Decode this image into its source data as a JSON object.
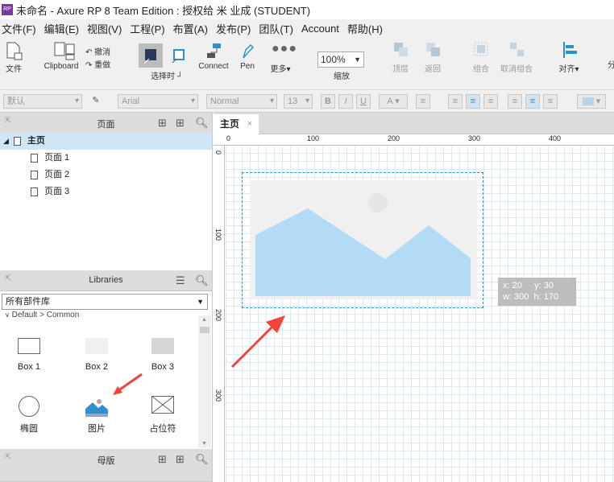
{
  "window": {
    "title": "未命名 - Axure RP 8 Team Edition : 授权给 米 业成 (STUDENT)",
    "logo": "RP"
  },
  "menu": [
    "文件(F)",
    "编辑(E)",
    "视图(V)",
    "工程(P)",
    "布置(A)",
    "发布(P)",
    "团队(T)",
    "Account",
    "帮助(H)"
  ],
  "toolbar": {
    "file": "文件",
    "clipboard": "Clipboard",
    "undo": "撤消",
    "redo": "重做",
    "select": "选择时",
    "connect": "Connect",
    "pen": "Pen",
    "more": "更多▾",
    "zoom_value": "100%",
    "zoom": "缩放",
    "top": "顶层",
    "back": "返回",
    "group": "组合",
    "ungroup": "取消组合",
    "align": "对齐▾",
    "dist": "分"
  },
  "formatbar": {
    "style": "默认",
    "font": "Arial",
    "weight": "Normal",
    "size": "13",
    "bold": "B",
    "italic": "I",
    "underline": "U",
    "color_a": "A"
  },
  "pages": {
    "title": "页面",
    "root": "主页",
    "children": [
      "页面 1",
      "页面 2",
      "页面 3"
    ]
  },
  "libraries": {
    "title": "Libraries",
    "select": "所有部件库",
    "group": "Default > Common",
    "widgets": [
      "Box 1",
      "Box 2",
      "Box 3",
      "椭圆",
      "图片",
      "占位符"
    ]
  },
  "masters": {
    "title": "母版"
  },
  "canvas": {
    "tab": "主页",
    "tab_close": "×",
    "ruler_h": [
      "0",
      "100",
      "200",
      "300",
      "400"
    ],
    "ruler_v": [
      "0",
      "100",
      "200",
      "300"
    ],
    "coords": {
      "x": "x: 20",
      "y": "y: 30",
      "w": "w: 300",
      "h": "h: 170"
    }
  },
  "colors": {
    "image_fill": "#b3dbf5",
    "accent": "#2f90d0",
    "arrow": "#f04438"
  }
}
